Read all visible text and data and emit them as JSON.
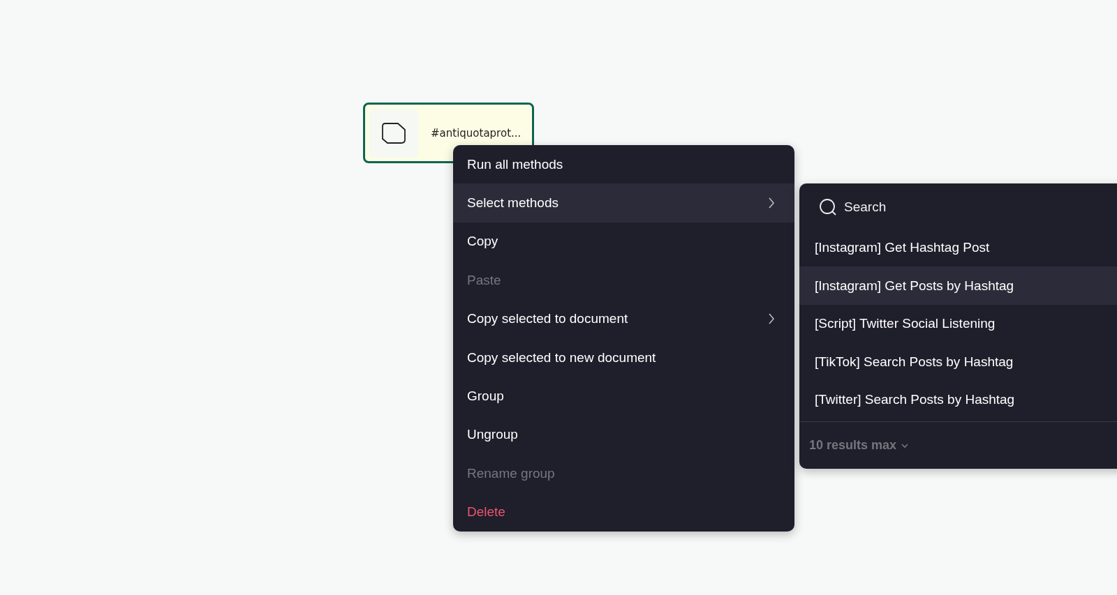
{
  "node": {
    "label": "#antiquotaprot...",
    "selected": true
  },
  "context_menu": {
    "items": [
      {
        "label": "Run all methods",
        "kind": "normal",
        "selected": false,
        "has_submenu": false
      },
      {
        "label": "Select methods",
        "kind": "normal",
        "selected": true,
        "has_submenu": true
      },
      {
        "label": "Copy",
        "kind": "normal",
        "selected": false,
        "has_submenu": false
      },
      {
        "label": "Paste",
        "kind": "disabled",
        "selected": false,
        "has_submenu": false
      },
      {
        "label": "Copy selected to document",
        "kind": "normal",
        "selected": false,
        "has_submenu": true
      },
      {
        "label": "Copy selected to new document",
        "kind": "normal",
        "selected": false,
        "has_submenu": false
      },
      {
        "label": "Group",
        "kind": "normal",
        "selected": false,
        "has_submenu": false
      },
      {
        "label": "Ungroup",
        "kind": "normal",
        "selected": false,
        "has_submenu": false
      },
      {
        "label": "Rename group",
        "kind": "disabled",
        "selected": false,
        "has_submenu": false
      },
      {
        "label": "Delete",
        "kind": "danger",
        "selected": false,
        "has_submenu": false
      }
    ]
  },
  "submenu": {
    "search": {
      "placeholder": "Search"
    },
    "items": [
      {
        "label": "[Instagram] Get Hashtag Post",
        "selected": false
      },
      {
        "label": "[Instagram] Get Posts by Hashtag",
        "selected": true
      },
      {
        "label": "[Script] Twitter Social Listening",
        "selected": false
      },
      {
        "label": "[TikTok] Search Posts by Hashtag",
        "selected": false
      },
      {
        "label": "[Twitter] Search Posts by Hashtag",
        "selected": false
      }
    ],
    "footer": "10 results max"
  }
}
